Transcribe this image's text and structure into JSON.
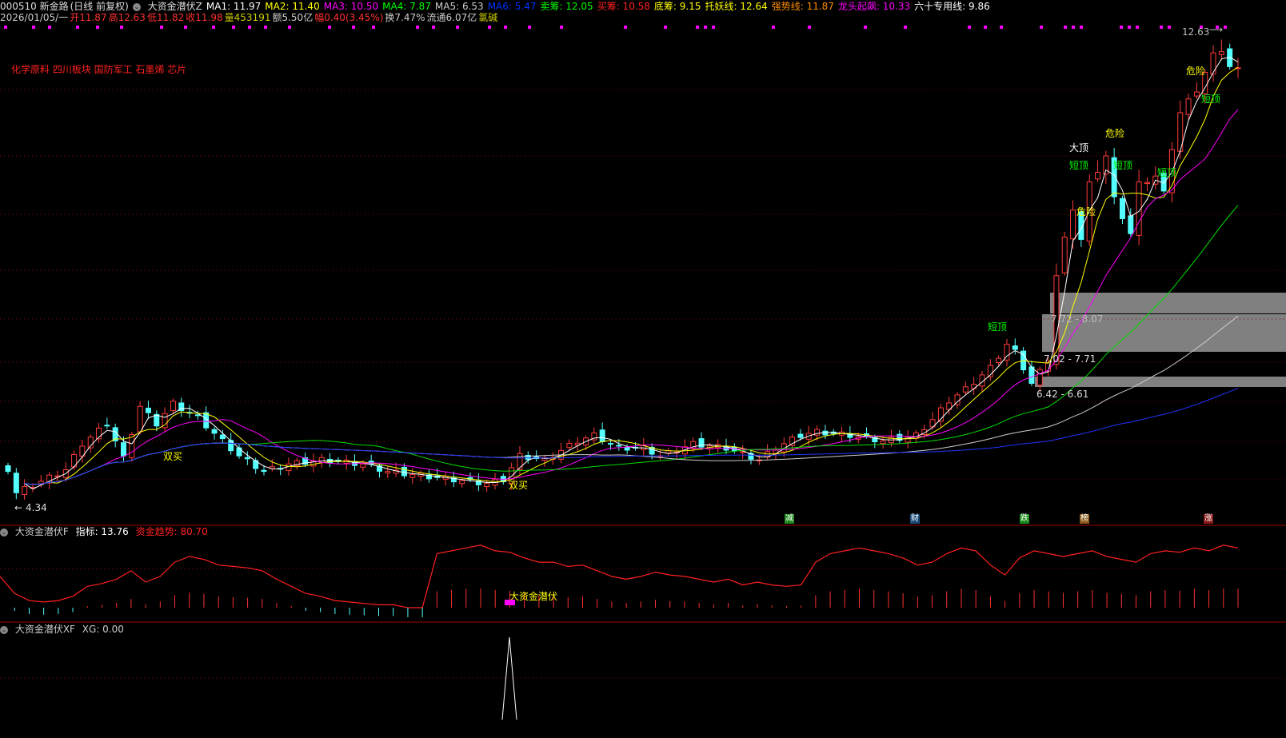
{
  "header": {
    "code_name": "000510 新金路",
    "period": "(日线 前复权)",
    "indicator_name": "大资金潜伏Z",
    "ma": [
      {
        "label": "MA1: 11.97",
        "color": "#ffffff"
      },
      {
        "label": "MA2: 11.40",
        "color": "#ffff00"
      },
      {
        "label": "MA3: 10.50",
        "color": "#ff00ff"
      },
      {
        "label": "MA4: 7.87",
        "color": "#00ff00"
      },
      {
        "label": "MA5: 6.53",
        "color": "#cccccc"
      },
      {
        "label": "MA6: 5.47",
        "color": "#0033ff"
      },
      {
        "label": "卖筹: 12.05",
        "color": "#00ff00"
      },
      {
        "label": "买筹: 10.58",
        "color": "#ff2020"
      },
      {
        "label": "底筹: 9.15",
        "color": "#ffff00"
      },
      {
        "label": "托妖线: 12.64",
        "color": "#ffff00"
      },
      {
        "label": "强势线: 11.87",
        "color": "#ff8c00"
      },
      {
        "label": "龙头起飙: 10.33",
        "color": "#ff00ff"
      },
      {
        "label": "六十专用线: 9.86",
        "color": "#ffffff"
      }
    ],
    "quote": [
      {
        "label": "2026/01/05/一",
        "color": "#cccccc"
      },
      {
        "label": "开11.87",
        "color": "#ff3030"
      },
      {
        "label": "高12.63",
        "color": "#ff3030"
      },
      {
        "label": "低11.82",
        "color": "#ff3030"
      },
      {
        "label": "收11.98",
        "color": "#ff3030"
      },
      {
        "label": "量453191",
        "color": "#cccc00"
      },
      {
        "label": "额5.50亿",
        "color": "#cccccc"
      },
      {
        "label": "幅0.40(3.45%)",
        "color": "#ff3030"
      },
      {
        "label": "换7.47%",
        "color": "#cccccc"
      },
      {
        "label": "流通6.07亿",
        "color": "#cccccc"
      },
      {
        "label": "氯碱",
        "color": "#cccc00"
      }
    ]
  },
  "concepts": "化学原料 四川板块 国防军工 石墨烯 芯片",
  "price_labels": {
    "high": "12.63",
    "low": "4.34"
  },
  "zones": [
    {
      "label": "7.72 - 8.07"
    },
    {
      "label": "7.02 - 7.71"
    },
    {
      "label": "6.42 - 6.61"
    }
  ],
  "annotations": [
    {
      "text": "双买",
      "color": "#ffff00"
    },
    {
      "text": "双买",
      "color": "#ffff00"
    },
    {
      "text": "短顶",
      "color": "#00ff00"
    },
    {
      "text": "大顶",
      "color": "#ffffff"
    },
    {
      "text": "短顶",
      "color": "#00ff00"
    },
    {
      "text": "危险",
      "color": "#ffff00"
    },
    {
      "text": "危险",
      "color": "#ffff00"
    },
    {
      "text": "短顶",
      "color": "#00ff00"
    },
    {
      "text": "短顶",
      "color": "#00ff00"
    },
    {
      "text": "危险",
      "color": "#ffff00"
    },
    {
      "text": "短顶",
      "color": "#00ff00"
    }
  ],
  "badges": [
    {
      "text": "减",
      "color": "#1a8a1a"
    },
    {
      "text": "财",
      "color": "#1a4a7a"
    },
    {
      "text": "跌",
      "color": "#1a8a1a"
    },
    {
      "text": "榜",
      "color": "#8a5a1a"
    },
    {
      "text": "涨",
      "color": "#8a1a1a"
    }
  ],
  "panel2": {
    "name": "大资金潜伏F",
    "index_label": "指标: 13.76",
    "trend_label": "资金趋势: 80.70",
    "signal": "大资金潜伏"
  },
  "panel3": {
    "name": "大资金潜伏XF",
    "xg_label": "XG: 0.00"
  },
  "chart_data": {
    "type": "candlestick",
    "price_path": [
      [
        0,
        4.97
      ],
      [
        1,
        4.6
      ],
      [
        4,
        4.8
      ],
      [
        7,
        5.0
      ],
      [
        9,
        5.45
      ],
      [
        12,
        5.8
      ],
      [
        14,
        5.2
      ],
      [
        16,
        6.1
      ],
      [
        18,
        5.8
      ],
      [
        20,
        6.15
      ],
      [
        23,
        5.9
      ],
      [
        26,
        5.5
      ],
      [
        28,
        5.24
      ],
      [
        31,
        4.97
      ],
      [
        34,
        5.1
      ],
      [
        38,
        5.17
      ],
      [
        43,
        5.1
      ],
      [
        46,
        4.97
      ],
      [
        50,
        4.9
      ],
      [
        54,
        4.83
      ],
      [
        58,
        4.76
      ],
      [
        60,
        4.83
      ],
      [
        62,
        5.24
      ],
      [
        65,
        5.17
      ],
      [
        69,
        5.5
      ],
      [
        71,
        5.6
      ],
      [
        74,
        5.38
      ],
      [
        77,
        5.38
      ],
      [
        79,
        5.24
      ],
      [
        83,
        5.45
      ],
      [
        87,
        5.38
      ],
      [
        91,
        5.17
      ],
      [
        93,
        5.38
      ],
      [
        96,
        5.6
      ],
      [
        98,
        5.66
      ],
      [
        102,
        5.6
      ],
      [
        106,
        5.5
      ],
      [
        110,
        5.6
      ],
      [
        112,
        5.87
      ],
      [
        114,
        6.2
      ],
      [
        116,
        6.4
      ],
      [
        119,
        6.77
      ],
      [
        121,
        7.18
      ],
      [
        122,
        7.05
      ],
      [
        124,
        6.5
      ],
      [
        126,
        6.9
      ],
      [
        127,
        8.37
      ],
      [
        128,
        9.0
      ],
      [
        129,
        9.55
      ],
      [
        130,
        9.0
      ],
      [
        131,
        9.96
      ],
      [
        133,
        10.45
      ],
      [
        134,
        9.7
      ],
      [
        136,
        9.1
      ],
      [
        137,
        9.96
      ],
      [
        139,
        10.1
      ],
      [
        140,
        9.8
      ],
      [
        141,
        10.6
      ],
      [
        142,
        11.2
      ],
      [
        144,
        11.6
      ],
      [
        145,
        11.9
      ],
      [
        146,
        12.2
      ],
      [
        147,
        12.3
      ],
      [
        148,
        12.0
      ],
      [
        149,
        11.98
      ]
    ],
    "ylim": [
      4.34,
      12.63
    ],
    "indicator_trend": [
      62,
      50,
      45,
      44,
      45,
      48,
      55,
      57,
      60,
      66,
      58,
      62,
      72,
      76,
      74,
      70,
      69,
      68,
      66,
      60,
      55,
      50,
      48,
      45,
      44,
      43,
      42,
      42,
      40,
      40,
      78,
      80,
      82,
      84,
      80,
      79,
      75,
      72,
      72,
      69,
      70,
      66,
      62,
      60,
      62,
      65,
      63,
      62,
      60,
      58,
      60,
      56,
      58,
      56,
      55,
      56,
      72,
      78,
      80,
      82,
      80,
      78,
      75,
      70,
      72,
      78,
      82,
      80,
      70,
      63,
      75,
      80,
      78,
      76,
      78,
      80,
      76,
      74,
      72,
      78,
      80,
      79,
      82,
      80,
      84,
      82
    ]
  }
}
